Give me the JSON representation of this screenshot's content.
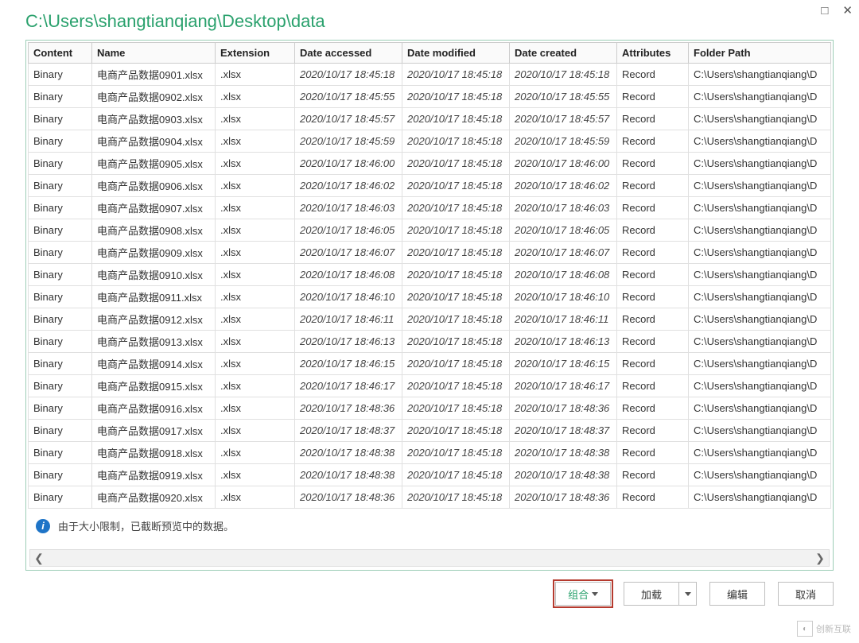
{
  "window": {
    "maximize_glyph": "□",
    "close_glyph": "✕"
  },
  "path_title": "C:\\Users\\shangtianqiang\\Desktop\\data",
  "columns": {
    "content": "Content",
    "name": "Name",
    "extension": "Extension",
    "accessed": "Date accessed",
    "modified": "Date modified",
    "created": "Date created",
    "attributes": "Attributes",
    "folder_path": "Folder Path"
  },
  "rows": [
    {
      "content": "Binary",
      "name": "电商产品数据0901.xlsx",
      "ext": ".xlsx",
      "accessed": "2020/10/17 18:45:18",
      "modified": "2020/10/17 18:45:18",
      "created": "2020/10/17 18:45:18",
      "attr": "Record",
      "path": "C:\\Users\\shangtianqiang\\D"
    },
    {
      "content": "Binary",
      "name": "电商产品数据0902.xlsx",
      "ext": ".xlsx",
      "accessed": "2020/10/17 18:45:55",
      "modified": "2020/10/17 18:45:18",
      "created": "2020/10/17 18:45:55",
      "attr": "Record",
      "path": "C:\\Users\\shangtianqiang\\D"
    },
    {
      "content": "Binary",
      "name": "电商产品数据0903.xlsx",
      "ext": ".xlsx",
      "accessed": "2020/10/17 18:45:57",
      "modified": "2020/10/17 18:45:18",
      "created": "2020/10/17 18:45:57",
      "attr": "Record",
      "path": "C:\\Users\\shangtianqiang\\D"
    },
    {
      "content": "Binary",
      "name": "电商产品数据0904.xlsx",
      "ext": ".xlsx",
      "accessed": "2020/10/17 18:45:59",
      "modified": "2020/10/17 18:45:18",
      "created": "2020/10/17 18:45:59",
      "attr": "Record",
      "path": "C:\\Users\\shangtianqiang\\D"
    },
    {
      "content": "Binary",
      "name": "电商产品数据0905.xlsx",
      "ext": ".xlsx",
      "accessed": "2020/10/17 18:46:00",
      "modified": "2020/10/17 18:45:18",
      "created": "2020/10/17 18:46:00",
      "attr": "Record",
      "path": "C:\\Users\\shangtianqiang\\D"
    },
    {
      "content": "Binary",
      "name": "电商产品数据0906.xlsx",
      "ext": ".xlsx",
      "accessed": "2020/10/17 18:46:02",
      "modified": "2020/10/17 18:45:18",
      "created": "2020/10/17 18:46:02",
      "attr": "Record",
      "path": "C:\\Users\\shangtianqiang\\D"
    },
    {
      "content": "Binary",
      "name": "电商产品数据0907.xlsx",
      "ext": ".xlsx",
      "accessed": "2020/10/17 18:46:03",
      "modified": "2020/10/17 18:45:18",
      "created": "2020/10/17 18:46:03",
      "attr": "Record",
      "path": "C:\\Users\\shangtianqiang\\D"
    },
    {
      "content": "Binary",
      "name": "电商产品数据0908.xlsx",
      "ext": ".xlsx",
      "accessed": "2020/10/17 18:46:05",
      "modified": "2020/10/17 18:45:18",
      "created": "2020/10/17 18:46:05",
      "attr": "Record",
      "path": "C:\\Users\\shangtianqiang\\D"
    },
    {
      "content": "Binary",
      "name": "电商产品数据0909.xlsx",
      "ext": ".xlsx",
      "accessed": "2020/10/17 18:46:07",
      "modified": "2020/10/17 18:45:18",
      "created": "2020/10/17 18:46:07",
      "attr": "Record",
      "path": "C:\\Users\\shangtianqiang\\D"
    },
    {
      "content": "Binary",
      "name": "电商产品数据0910.xlsx",
      "ext": ".xlsx",
      "accessed": "2020/10/17 18:46:08",
      "modified": "2020/10/17 18:45:18",
      "created": "2020/10/17 18:46:08",
      "attr": "Record",
      "path": "C:\\Users\\shangtianqiang\\D"
    },
    {
      "content": "Binary",
      "name": "电商产品数据0911.xlsx",
      "ext": ".xlsx",
      "accessed": "2020/10/17 18:46:10",
      "modified": "2020/10/17 18:45:18",
      "created": "2020/10/17 18:46:10",
      "attr": "Record",
      "path": "C:\\Users\\shangtianqiang\\D"
    },
    {
      "content": "Binary",
      "name": "电商产品数据0912.xlsx",
      "ext": ".xlsx",
      "accessed": "2020/10/17 18:46:11",
      "modified": "2020/10/17 18:45:18",
      "created": "2020/10/17 18:46:11",
      "attr": "Record",
      "path": "C:\\Users\\shangtianqiang\\D"
    },
    {
      "content": "Binary",
      "name": "电商产品数据0913.xlsx",
      "ext": ".xlsx",
      "accessed": "2020/10/17 18:46:13",
      "modified": "2020/10/17 18:45:18",
      "created": "2020/10/17 18:46:13",
      "attr": "Record",
      "path": "C:\\Users\\shangtianqiang\\D"
    },
    {
      "content": "Binary",
      "name": "电商产品数据0914.xlsx",
      "ext": ".xlsx",
      "accessed": "2020/10/17 18:46:15",
      "modified": "2020/10/17 18:45:18",
      "created": "2020/10/17 18:46:15",
      "attr": "Record",
      "path": "C:\\Users\\shangtianqiang\\D"
    },
    {
      "content": "Binary",
      "name": "电商产品数据0915.xlsx",
      "ext": ".xlsx",
      "accessed": "2020/10/17 18:46:17",
      "modified": "2020/10/17 18:45:18",
      "created": "2020/10/17 18:46:17",
      "attr": "Record",
      "path": "C:\\Users\\shangtianqiang\\D"
    },
    {
      "content": "Binary",
      "name": "电商产品数据0916.xlsx",
      "ext": ".xlsx",
      "accessed": "2020/10/17 18:48:36",
      "modified": "2020/10/17 18:45:18",
      "created": "2020/10/17 18:48:36",
      "attr": "Record",
      "path": "C:\\Users\\shangtianqiang\\D"
    },
    {
      "content": "Binary",
      "name": "电商产品数据0917.xlsx",
      "ext": ".xlsx",
      "accessed": "2020/10/17 18:48:37",
      "modified": "2020/10/17 18:45:18",
      "created": "2020/10/17 18:48:37",
      "attr": "Record",
      "path": "C:\\Users\\shangtianqiang\\D"
    },
    {
      "content": "Binary",
      "name": "电商产品数据0918.xlsx",
      "ext": ".xlsx",
      "accessed": "2020/10/17 18:48:38",
      "modified": "2020/10/17 18:45:18",
      "created": "2020/10/17 18:48:38",
      "attr": "Record",
      "path": "C:\\Users\\shangtianqiang\\D"
    },
    {
      "content": "Binary",
      "name": "电商产品数据0919.xlsx",
      "ext": ".xlsx",
      "accessed": "2020/10/17 18:48:38",
      "modified": "2020/10/17 18:45:18",
      "created": "2020/10/17 18:48:38",
      "attr": "Record",
      "path": "C:\\Users\\shangtianqiang\\D"
    },
    {
      "content": "Binary",
      "name": "电商产品数据0920.xlsx",
      "ext": ".xlsx",
      "accessed": "2020/10/17 18:48:36",
      "modified": "2020/10/17 18:45:18",
      "created": "2020/10/17 18:48:36",
      "attr": "Record",
      "path": "C:\\Users\\shangtianqiang\\D"
    }
  ],
  "info_message": "由于大小限制，已截断预览中的数据。",
  "buttons": {
    "combine": "组合",
    "load": "加载",
    "edit": "编辑",
    "cancel": "取消"
  },
  "watermark": "创新互联"
}
